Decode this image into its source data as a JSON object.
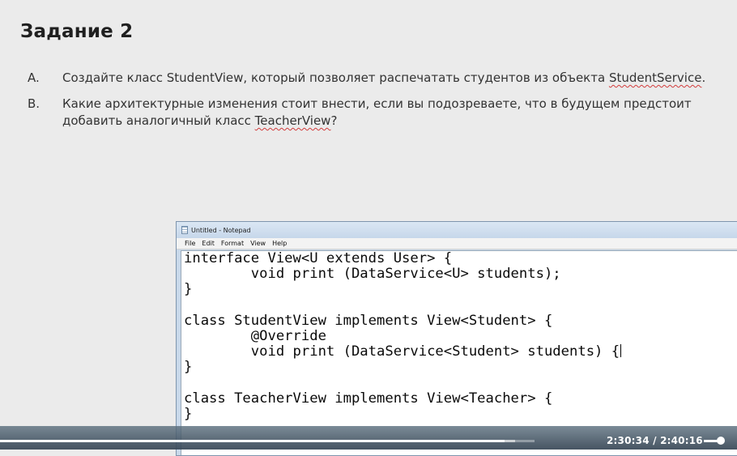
{
  "slide": {
    "title": "Задание 2",
    "tasks": [
      {
        "marker": "A.",
        "text_before": "Создайте класс StudentView, который позволяет распечатать студентов из объекта ",
        "squiggle": "StudentService",
        "text_after": "."
      },
      {
        "marker": "B.",
        "text_before": "Какие архитектурные изменения стоит внести, если вы подозреваете, что в будущем предстоит добавить аналогичный класс ",
        "squiggle": "TeacherView",
        "text_after": "?"
      }
    ]
  },
  "notepad": {
    "title": "Untitled - Notepad",
    "menu": [
      "File",
      "Edit",
      "Format",
      "View",
      "Help"
    ],
    "lines": [
      "interface View<U extends User> {",
      "        void print (DataService<U> students);",
      "}",
      "",
      "class StudentView implements View<Student> {",
      "        @Override",
      "        void print (DataService<Student> students) {",
      "}",
      "",
      "class TeacherView implements View<Teacher> {",
      "}"
    ]
  },
  "player": {
    "time": "2:30:34 / 2:40:16",
    "progress_fraction": 0.9433,
    "volume_fraction": 1.0
  }
}
